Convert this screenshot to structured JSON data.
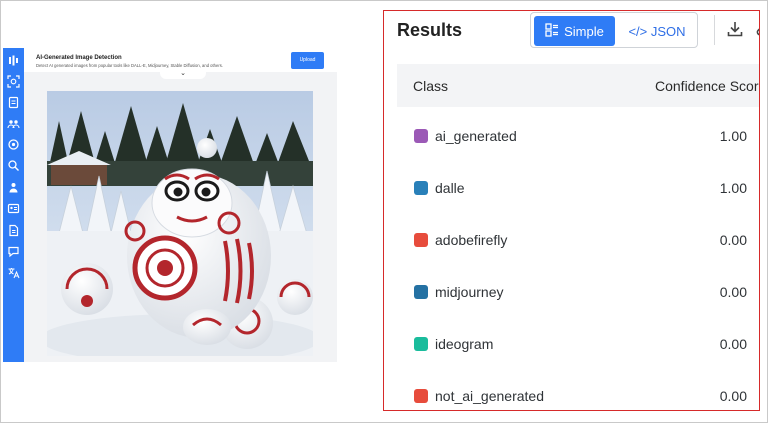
{
  "preview": {
    "title": "AI-Generated Image Detection",
    "subtitle": "Detect AI generated images from popular tools like DALL-E, Midjourney, Stable Diffusion, and others.",
    "upload_label": "Upload",
    "collapse_glyph": "⌄",
    "sidebar_icons": [
      "bars-icon",
      "face-scan-icon",
      "document-scan-icon",
      "people-icon",
      "settings-icon",
      "search-icon",
      "users-icon",
      "id-card-icon",
      "document-icon",
      "chat-icon",
      "translate-icon"
    ]
  },
  "results": {
    "title": "Results",
    "toggle": {
      "simple_label": "Simple",
      "json_label": "</> JSON"
    },
    "table": {
      "headers": [
        "Class",
        "Confidence Score"
      ],
      "rows": [
        {
          "label": "ai_generated",
          "score": "1.00",
          "color": "#9b59b6"
        },
        {
          "label": "dalle",
          "score": "1.00",
          "color": "#2980b9"
        },
        {
          "label": "adobefirefly",
          "score": "0.00",
          "color": "#e74c3c"
        },
        {
          "label": "midjourney",
          "score": "0.00",
          "color": "#2471a3"
        },
        {
          "label": "ideogram",
          "score": "0.00",
          "color": "#1abc9c"
        },
        {
          "label": "not_ai_generated",
          "score": "0.00",
          "color": "#e74c3c"
        }
      ]
    }
  },
  "colors": {
    "accent": "#2f7cf6",
    "highlight_border": "#d62a2a"
  }
}
